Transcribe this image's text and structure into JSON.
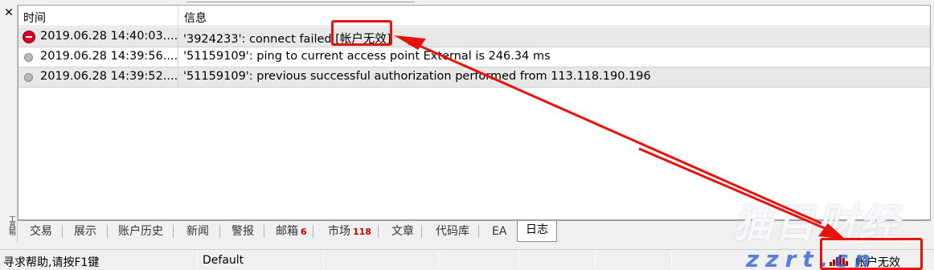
{
  "window": {
    "close_glyph": "✕",
    "side_label": "工具箱"
  },
  "table": {
    "columns": {
      "time": "时间",
      "message": "信息"
    },
    "rows": [
      {
        "icon": "error-icon",
        "time": "2019.06.28 14:40:03....",
        "message": "'3924233': connect failed [帐户无效]"
      },
      {
        "icon": "info-dot-icon",
        "time": "2019.06.28 14:39:56....",
        "message": "'51159109': ping to current access point External is 246.34 ms"
      },
      {
        "icon": "info-dot-icon",
        "time": "2019.06.28 14:39:52....",
        "message": "'51159109': previous successful authorization performed from 113.118.190.196"
      }
    ]
  },
  "tabs": [
    {
      "label": "交易",
      "badge": ""
    },
    {
      "label": "展示",
      "badge": ""
    },
    {
      "label": "账户历史",
      "badge": ""
    },
    {
      "label": "新闻",
      "badge": ""
    },
    {
      "label": "警报",
      "badge": ""
    },
    {
      "label": "邮箱",
      "badge": "6"
    },
    {
      "label": "市场",
      "badge": "118"
    },
    {
      "label": "文章",
      "badge": ""
    },
    {
      "label": "代码库",
      "badge": ""
    },
    {
      "label": "EA",
      "badge": ""
    },
    {
      "label": "日志",
      "badge": "",
      "active": true
    }
  ],
  "statusbar": {
    "help": "寻求帮助,请按F1键",
    "profile": "Default",
    "connection": "帐户无效"
  },
  "watermark": {
    "cn": "猫目财经",
    "en": "zzrt.cn"
  },
  "colors": {
    "annotation": "#e8120c",
    "error": "#d8001c",
    "badge": "#c00000"
  }
}
